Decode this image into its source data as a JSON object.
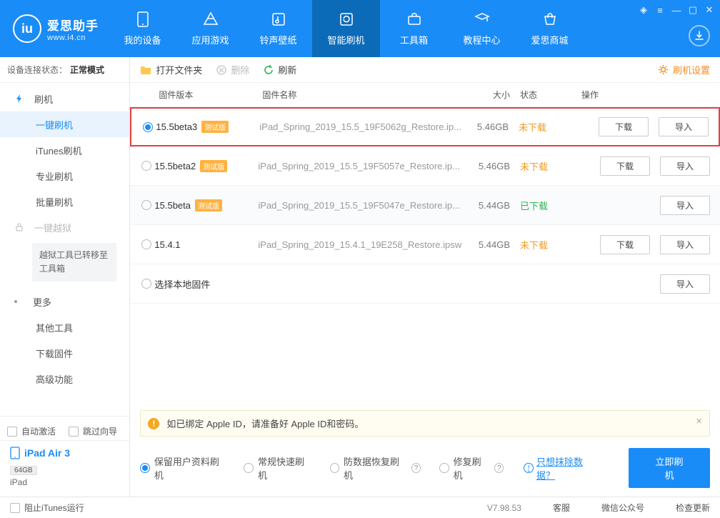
{
  "header": {
    "app_title": "爱思助手",
    "app_subtitle": "www.i4.cn",
    "nav": [
      "我的设备",
      "应用游戏",
      "铃声壁纸",
      "智能刷机",
      "工具箱",
      "教程中心",
      "爱思商城"
    ],
    "nav_active": 3
  },
  "sidebar": {
    "status_label": "设备连接状态：",
    "status_value": "正常模式",
    "flash_group": "刷机",
    "flash_items": [
      "一键刷机",
      "iTunes刷机",
      "专业刷机",
      "批量刷机"
    ],
    "flash_active": 0,
    "jailbreak": "一键越狱",
    "jailbreak_notice": "越狱工具已转移至工具箱",
    "more_group": "更多",
    "more_items": [
      "其他工具",
      "下载固件",
      "高级功能"
    ],
    "auto_activate": "自动激活",
    "skip_guide": "跳过向导",
    "device": {
      "name": "iPad Air 3",
      "capacity": "64GB",
      "type": "iPad"
    }
  },
  "toolbar": {
    "open_folder": "打开文件夹",
    "delete": "删除",
    "refresh": "刷新",
    "settings": "刷机设置"
  },
  "table": {
    "headers": {
      "version": "固件版本",
      "name": "固件名称",
      "size": "大小",
      "status": "状态",
      "ops": "操作"
    },
    "download_btn": "下载",
    "import_btn": "导入",
    "status_undownloaded": "未下载",
    "status_downloaded": "已下载",
    "beta_tag": "测试版",
    "local_label": "选择本地固件",
    "rows": [
      {
        "version": "15.5beta3",
        "beta": true,
        "name": "iPad_Spring_2019_15.5_19F5062g_Restore.ip...",
        "size": "5.46GB",
        "status": "undl",
        "selected": true,
        "highlight": true
      },
      {
        "version": "15.5beta2",
        "beta": true,
        "name": "iPad_Spring_2019_15.5_19F5057e_Restore.ip...",
        "size": "5.46GB",
        "status": "undl"
      },
      {
        "version": "15.5beta",
        "beta": true,
        "name": "iPad_Spring_2019_15.5_19F5047e_Restore.ip...",
        "size": "5.44GB",
        "status": "done",
        "striped": true
      },
      {
        "version": "15.4.1",
        "beta": false,
        "name": "iPad_Spring_2019_15.4.1_19E258_Restore.ipsw",
        "size": "5.44GB",
        "status": "undl"
      }
    ]
  },
  "notice": "如已绑定 Apple ID，请准备好 Apple ID和密码。",
  "flash_opts": {
    "opts": [
      "保留用户资料刷机",
      "常规快速刷机",
      "防数据恢复刷机",
      "修复刷机"
    ],
    "selected": 0,
    "erase_link": "只想抹除数据？",
    "flash_btn": "立即刷机"
  },
  "statusbar": {
    "block_itunes": "阻止iTunes运行",
    "version": "V7.98.53",
    "cs": "客服",
    "wechat": "微信公众号",
    "update": "检查更新"
  }
}
